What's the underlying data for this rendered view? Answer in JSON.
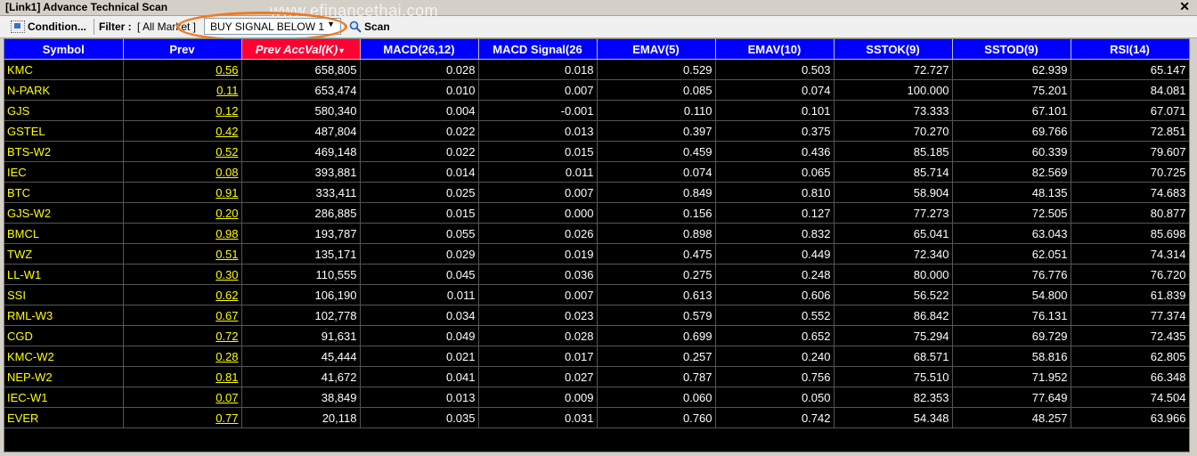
{
  "window": {
    "title": "[Link1] Advance Technical Scan",
    "close": "✕"
  },
  "watermark": "www.efinancethai.com",
  "toolbar": {
    "condition_label": "Condition...",
    "filter_label": "Filter :",
    "filter_value": "[ All Market ]",
    "signal_value": "BUY SIGNAL BELOW 1",
    "scan_label": "Scan"
  },
  "columns": [
    "Symbol",
    "Prev",
    "Prev AccVal(K)",
    "MACD(26,12)",
    "MACD Signal(26",
    "EMAV(5)",
    "EMAV(10)",
    "SSTOK(9)",
    "SSTOD(9)",
    "RSI(14)"
  ],
  "rows": [
    [
      "KMC",
      "0.56",
      "658,805",
      "0.028",
      "0.018",
      "0.529",
      "0.503",
      "72.727",
      "62.939",
      "65.147"
    ],
    [
      "N-PARK",
      "0.11",
      "653,474",
      "0.010",
      "0.007",
      "0.085",
      "0.074",
      "100.000",
      "75.201",
      "84.081"
    ],
    [
      "GJS",
      "0.12",
      "580,340",
      "0.004",
      "-0.001",
      "0.110",
      "0.101",
      "73.333",
      "67.101",
      "67.071"
    ],
    [
      "GSTEL",
      "0.42",
      "487,804",
      "0.022",
      "0.013",
      "0.397",
      "0.375",
      "70.270",
      "69.766",
      "72.851"
    ],
    [
      "BTS-W2",
      "0.52",
      "469,148",
      "0.022",
      "0.015",
      "0.459",
      "0.436",
      "85.185",
      "60.339",
      "79.607"
    ],
    [
      "IEC",
      "0.08",
      "393,881",
      "0.014",
      "0.011",
      "0.074",
      "0.065",
      "85.714",
      "82.569",
      "70.725"
    ],
    [
      "BTC",
      "0.91",
      "333,411",
      "0.025",
      "0.007",
      "0.849",
      "0.810",
      "58.904",
      "48.135",
      "74.683"
    ],
    [
      "GJS-W2",
      "0.20",
      "286,885",
      "0.015",
      "0.000",
      "0.156",
      "0.127",
      "77.273",
      "72.505",
      "80.877"
    ],
    [
      "BMCL",
      "0.98",
      "193,787",
      "0.055",
      "0.026",
      "0.898",
      "0.832",
      "65.041",
      "63.043",
      "85.698"
    ],
    [
      "TWZ",
      "0.51",
      "135,171",
      "0.029",
      "0.019",
      "0.475",
      "0.449",
      "72.340",
      "62.051",
      "74.314"
    ],
    [
      "LL-W1",
      "0.30",
      "110,555",
      "0.045",
      "0.036",
      "0.275",
      "0.248",
      "80.000",
      "76.776",
      "76.720"
    ],
    [
      "SSI",
      "0.62",
      "106,190",
      "0.011",
      "0.007",
      "0.613",
      "0.606",
      "56.522",
      "54.800",
      "61.839"
    ],
    [
      "RML-W3",
      "0.67",
      "102,778",
      "0.034",
      "0.023",
      "0.579",
      "0.552",
      "86.842",
      "76.131",
      "77.374"
    ],
    [
      "CGD",
      "0.72",
      "91,631",
      "0.049",
      "0.028",
      "0.699",
      "0.652",
      "75.294",
      "69.729",
      "72.435"
    ],
    [
      "KMC-W2",
      "0.28",
      "45,444",
      "0.021",
      "0.017",
      "0.257",
      "0.240",
      "68.571",
      "58.816",
      "62.805"
    ],
    [
      "NEP-W2",
      "0.81",
      "41,672",
      "0.041",
      "0.027",
      "0.787",
      "0.756",
      "75.510",
      "71.952",
      "66.348"
    ],
    [
      "IEC-W1",
      "0.07",
      "38,849",
      "0.013",
      "0.009",
      "0.060",
      "0.050",
      "82.353",
      "77.649",
      "74.504"
    ],
    [
      "EVER",
      "0.77",
      "20,118",
      "0.035",
      "0.031",
      "0.760",
      "0.742",
      "54.348",
      "48.257",
      "63.966"
    ]
  ]
}
